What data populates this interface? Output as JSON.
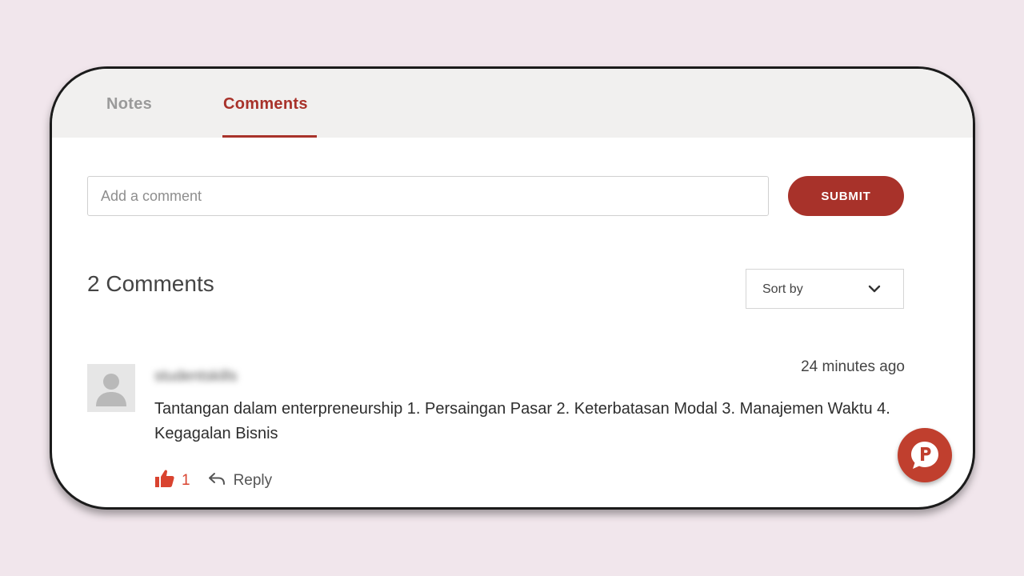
{
  "tabs": [
    {
      "label": "Notes",
      "active": false
    },
    {
      "label": "Comments",
      "active": true
    }
  ],
  "comment_form": {
    "placeholder": "Add a comment",
    "value": "",
    "submit_label": "SUBMIT"
  },
  "comments_section": {
    "count_heading": "2 Comments",
    "sort_label": "Sort by"
  },
  "comments": [
    {
      "username": "studentskills",
      "timestamp": "24 minutes ago",
      "text": "Tantangan dalam enterpreneurship 1. Persaingan Pasar 2. Keterbatasan Modal 3. Manajemen Waktu 4. Kegagalan Bisnis",
      "likes": "1",
      "reply_label": "Reply"
    }
  ],
  "colors": {
    "accent": "#a8322a",
    "like": "#d9432f",
    "background": "#f1e6ec",
    "tab_bar": "#f1f0ef"
  },
  "icons": [
    "chevron-down-icon",
    "avatar-placeholder-icon",
    "thumbs-up-icon",
    "reply-arrow-icon",
    "chat-bubble-p-icon"
  ]
}
